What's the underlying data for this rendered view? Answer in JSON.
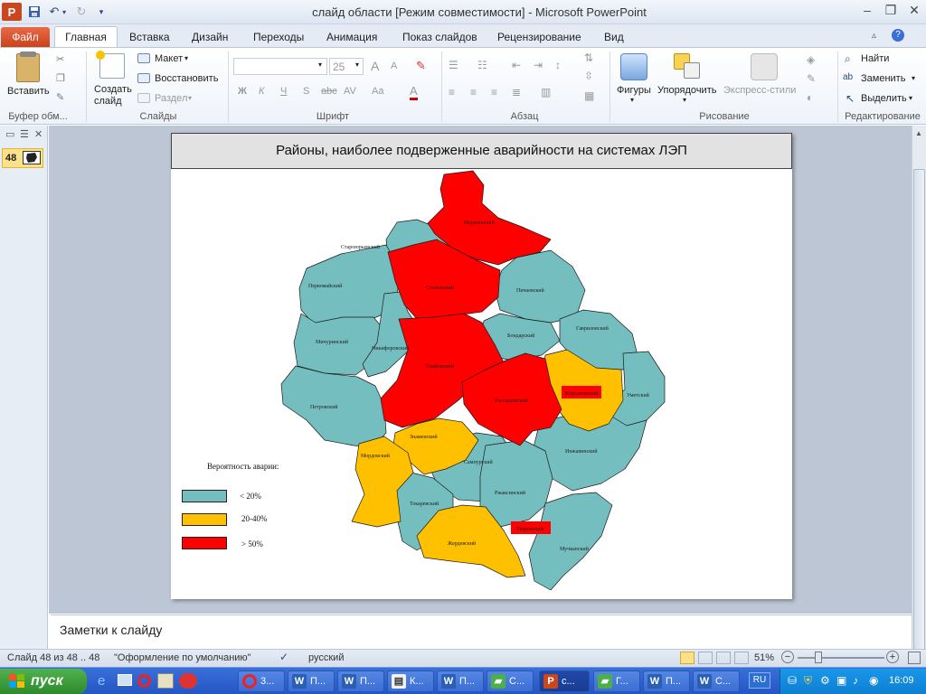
{
  "window": {
    "title": "слайд области [Режим совместимости]  -  Microsoft PowerPoint",
    "min_glyph": "–",
    "max_glyph": "❐",
    "close_glyph": "✕"
  },
  "tabs": {
    "file": "Файл",
    "items": [
      "Главная",
      "Вставка",
      "Дизайн",
      "Переходы",
      "Анимация",
      "Показ слайдов",
      "Рецензирование",
      "Вид"
    ],
    "help_glyph": "?"
  },
  "ribbon": {
    "clipboard": {
      "paste": "Вставить",
      "label": "Буфер обм..."
    },
    "slides": {
      "new_slide": "Создать\nслайд",
      "layout": "Макет",
      "reset": "Восстановить",
      "section": "Раздел",
      "label": "Слайды"
    },
    "font": {
      "font_name": "",
      "font_size": "25",
      "bold": "Ж",
      "italic": "К",
      "underline": "Ч",
      "shadow": "S",
      "strike": "abc",
      "spacing": "AV",
      "case": "Aa",
      "color": "A",
      "label": "Шрифт"
    },
    "paragraph": {
      "label": "Абзац"
    },
    "drawing": {
      "shapes": "Фигуры",
      "arrange": "Упорядочить",
      "quick_styles": "Экспресс-стили",
      "label": "Рисование"
    },
    "editing": {
      "find": "Найти",
      "replace": "Заменить",
      "select": "Выделить",
      "label": "Редактирование"
    }
  },
  "thumbnail": {
    "number": "48"
  },
  "slide": {
    "title": "Районы, наиболее подверженные  аварийности на системах ЛЭП",
    "legend": {
      "title": "Вероятность  аварии:",
      "items": [
        {
          "label": "< 20%",
          "color": "#75BEC0"
        },
        {
          "label": "20-40%",
          "color": "#FFC000"
        },
        {
          "label": "> 50%",
          "color": "#FF0000"
        }
      ]
    },
    "regions": [
      "Моршанский",
      "Староюрьевский",
      "Первомайский",
      "Сосновский",
      "Пичаевский",
      "Мичуринский",
      "Никифоровский",
      "Бондарский",
      "Гавриловский",
      "Тамбовский",
      "Кирсановский",
      "Уметский",
      "Рассказовский",
      "Петровский",
      "Знаменский",
      "Инжавинский",
      "Мордовский",
      "Сампурский",
      "Ржаксинский",
      "Токаревский",
      "Жердевский",
      "Уваровский",
      "Мучкапский"
    ]
  },
  "notes": {
    "placeholder": "Заметки к слайду"
  },
  "status": {
    "slide_info": "Слайд 48 из 48 .. 48",
    "theme": "\"Оформление по умолчанию\"",
    "language": "русский",
    "zoom": "51%"
  },
  "taskbar": {
    "start": "пуск",
    "items": [
      "3...",
      "П...",
      "П...",
      "К...",
      "П...",
      "С...",
      "с...",
      "Г...",
      "П...",
      "С..."
    ],
    "lang": "RU",
    "clock": "16:09"
  },
  "colors": {
    "low": "#75BEC0",
    "mid": "#FFC000",
    "high": "#FF0000",
    "accent": "#2456c4"
  }
}
